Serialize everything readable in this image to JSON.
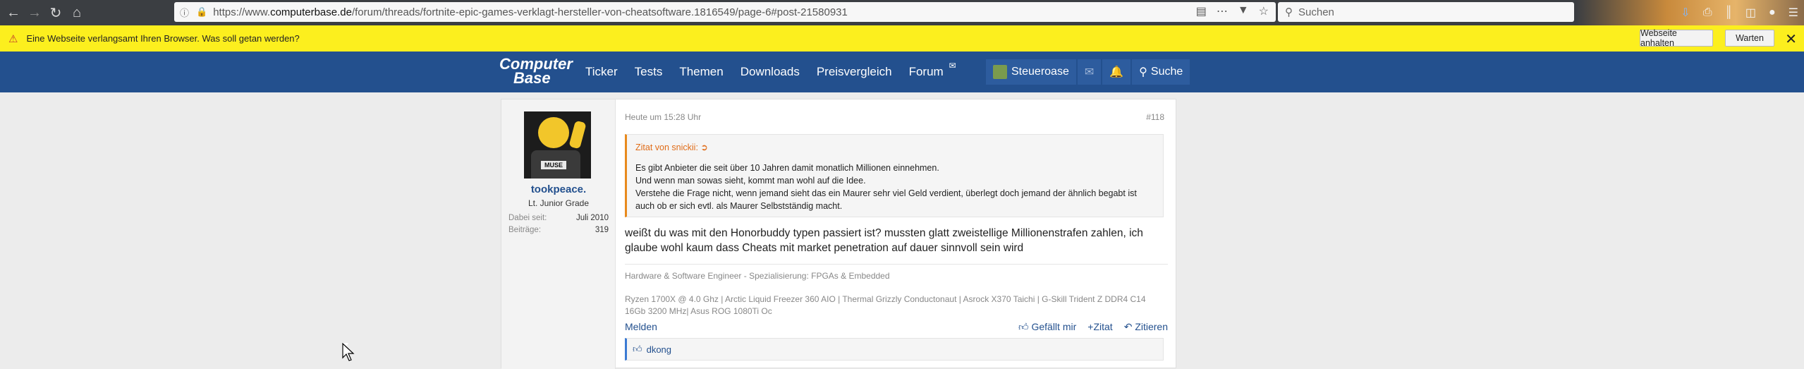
{
  "browser": {
    "url": "https://www.computerbase.de/forum/threads/fortnite-epic-games-verklagt-hersteller-von-cheatsoftware.1816549/page-6#post-21580931",
    "url_prefix": "https://www.",
    "url_site": "computerbase.de",
    "url_path": "/forum/threads/fortnite-epic-games-verklagt-hersteller-von-cheatsoftware.1816549/page-6#post-21580931",
    "search_placeholder": "Suchen"
  },
  "notification": {
    "text": "Eine Webseite verlangsamt Ihren Browser. Was soll getan werden?",
    "stop_label": "Webseite anhalten",
    "wait_label": "Warten"
  },
  "site": {
    "logo_line1": "Computer",
    "logo_line2": "Base",
    "nav": [
      "Ticker",
      "Tests",
      "Themen",
      "Downloads",
      "Preisvergleich",
      "Forum"
    ],
    "user": "Steueroase",
    "search_label": "Suche"
  },
  "post": {
    "author": "tookpeace.",
    "rank": "Lt. Junior Grade",
    "joined_label": "Dabei seit:",
    "joined_value": "Juli 2010",
    "posts_label": "Beiträge:",
    "posts_value": "319",
    "timestamp": "Heute um 15:28 Uhr",
    "number": "#118",
    "quote_header": "Zitat von snickii:",
    "quote_lines": [
      "Es gibt Anbieter die seit über 10 Jahren damit monatlich Millionen einnehmen.",
      "Und wenn man sowas sieht, kommt man wohl auf die Idee.",
      "Verstehe die Frage nicht, wenn jemand sieht das ein Maurer sehr viel Geld verdient, überlegt doch jemand der ähnlich begabt ist auch ob er sich evtl. als Maurer Selbstständig macht."
    ],
    "message": "weißt du was mit den Honorbuddy typen passiert ist? mussten glatt zweistellige Millionenstrafen zahlen, ich glaube wohl kaum dass Cheats mit market penetration auf dauer sinnvoll sein wird",
    "signature_line1": "Hardware & Software Engineer - Spezialisierung: FPGAs & Embedded",
    "signature_line2": "Ryzen 1700X @ 4.0 Ghz | Arctic Liquid Freezer 360 AIO | Thermal Grizzly Conductonaut | Asrock X370 Taichi | G-Skill Trident Z DDR4 C14 16Gb 3200 MHz| Asus ROG 1080Ti Oc",
    "report_label": "Melden",
    "like_label": "Gefällt mir",
    "quote_label": "Zitat",
    "reply_label": "Zitieren",
    "liked_by": "dkong"
  }
}
